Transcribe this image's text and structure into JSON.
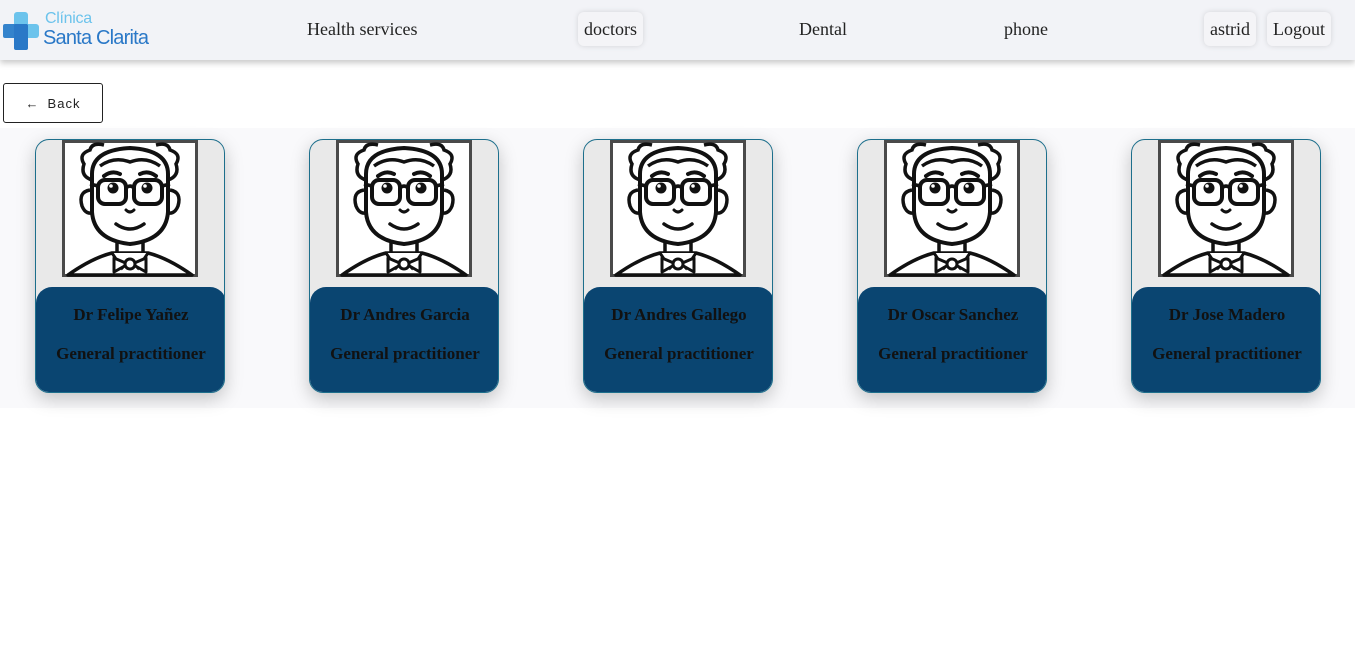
{
  "logo": {
    "line1": "Clínica",
    "line2": "Santa Clarita"
  },
  "nav": {
    "health_services": "Health services",
    "doctors": "doctors",
    "dental": "Dental",
    "phone": "phone",
    "user": "astrid",
    "logout": "Logout"
  },
  "back": {
    "arrow": "←",
    "label": "Back"
  },
  "doctors": [
    {
      "name": "Dr Felipe Yañez",
      "role": "General practitioner"
    },
    {
      "name": "Dr Andres Garcia",
      "role": "General practitioner"
    },
    {
      "name": "Dr Andres Gallego",
      "role": "General practitioner"
    },
    {
      "name": "Dr Oscar Sanchez",
      "role": "General practitioner"
    },
    {
      "name": "Dr Jose Madero",
      "role": "General practitioner"
    }
  ],
  "colors": {
    "card_info_bg": "#0a4571",
    "card_border": "#1d6f8c",
    "logo_blue": "#2a78c7",
    "logo_light": "#6cc3ec"
  }
}
